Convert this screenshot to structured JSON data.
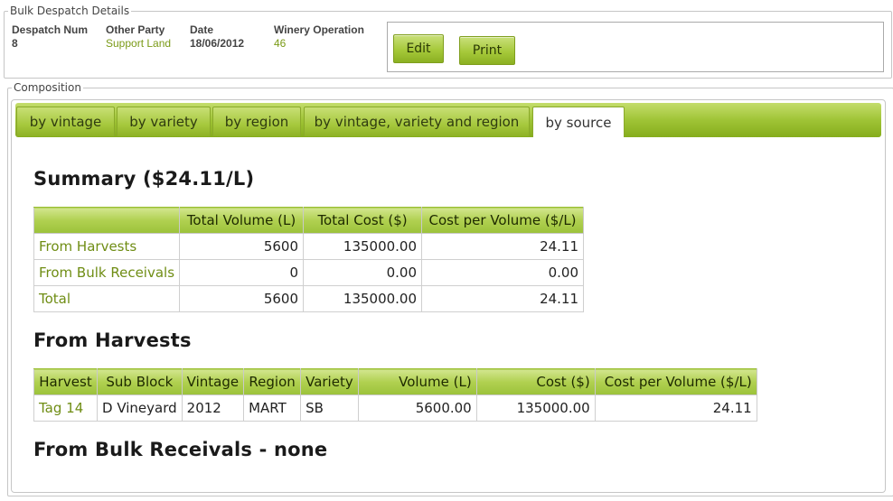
{
  "details": {
    "legend": "Bulk Despatch Details",
    "fields": [
      {
        "label": "Despatch Num",
        "value": "8"
      },
      {
        "label": "Other Party",
        "value": "Support Land"
      },
      {
        "label": "Date",
        "value": "18/06/2012"
      },
      {
        "label": "Winery Operation",
        "value": "46"
      }
    ],
    "edit_label": "Edit",
    "print_label": "Print"
  },
  "composition": {
    "legend": "Composition",
    "tabs": [
      {
        "label": "by vintage"
      },
      {
        "label": "by variety"
      },
      {
        "label": "by region"
      },
      {
        "label": "by vintage, variety and region"
      },
      {
        "label": "by source"
      }
    ],
    "active_tab": "by source"
  },
  "summary": {
    "heading": "Summary ($24.11/L)",
    "columns": [
      "",
      "Total Volume (L)",
      "Total Cost ($)",
      "Cost per Volume ($/L)"
    ],
    "rows": [
      {
        "label": "From Harvests",
        "volume": "5600",
        "cost": "135000.00",
        "cpv": "24.11"
      },
      {
        "label": "From Bulk Receivals",
        "volume": "0",
        "cost": "0.00",
        "cpv": "0.00"
      },
      {
        "label": "Total",
        "volume": "5600",
        "cost": "135000.00",
        "cpv": "24.11"
      }
    ]
  },
  "harvests": {
    "heading": "From Harvests",
    "columns": [
      "Harvest",
      "Sub Block",
      "Vintage",
      "Region",
      "Variety",
      "Volume (L)",
      "Cost ($)",
      "Cost per Volume ($/L)"
    ],
    "rows": [
      {
        "harvest": "Tag 14",
        "sub_block": "D Vineyard",
        "vintage": "2012",
        "region": "MART",
        "variety": "SB",
        "volume": "5600.00",
        "cost": "135000.00",
        "cpv": "24.11"
      }
    ]
  },
  "receivals": {
    "heading": "From Bulk Receivals - none"
  },
  "colors": {
    "accent_green": "#9fc436",
    "link_green": "#6f8d14"
  }
}
